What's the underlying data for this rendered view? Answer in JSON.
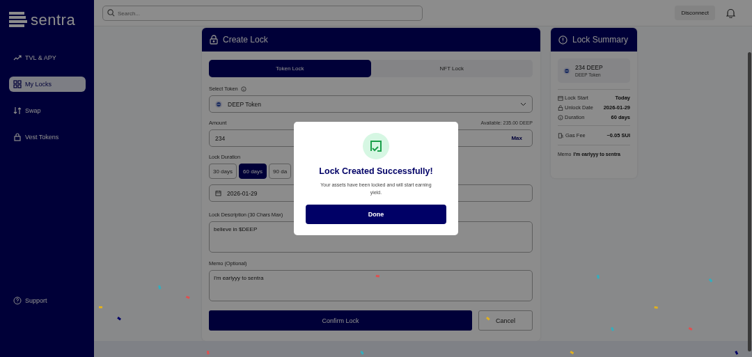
{
  "brand": {
    "name": "sentra"
  },
  "sidebar": {
    "items": [
      {
        "label": "TVL & APY",
        "selected": false
      },
      {
        "label": "My Locks",
        "selected": true
      },
      {
        "label": "Swap",
        "selected": false
      },
      {
        "label": "Vest Tokens",
        "selected": false
      }
    ],
    "footer": {
      "label": "Support"
    }
  },
  "topbar": {
    "search_placeholder": "Search...",
    "disconnect": "Disconnect"
  },
  "create_lock": {
    "title": "Create Lock",
    "tabs": [
      {
        "label": "Token Lock",
        "selected": true
      },
      {
        "label": "NFT Lock",
        "selected": false
      }
    ],
    "select_token": {
      "label": "Select Token",
      "value": "DEEP Token"
    },
    "amount": {
      "label": "Amount",
      "available": "Available: 235.00 DEEP",
      "value": "234",
      "max": "Max"
    },
    "duration": {
      "label": "Lock Duration",
      "options": [
        {
          "label": "30 days",
          "selected": false
        },
        {
          "label": "60 days",
          "selected": true
        },
        {
          "label": "90 da",
          "selected": false
        }
      ]
    },
    "date": {
      "value": "2026-01-29"
    },
    "description": {
      "label": "Lock Description (30 Chars Max)",
      "value": "believe in $DEEP"
    },
    "memo": {
      "label": "Memo (Optional)",
      "value": "I'm earlyyy to sentra"
    },
    "buttons": {
      "confirm": "Confirm Lock",
      "cancel": "Cancel"
    }
  },
  "summary": {
    "title": "Lock Summary",
    "amount": "234 DEEP",
    "token": "DEEP Token",
    "rows": [
      {
        "label": "Lock Start",
        "value": "Today"
      },
      {
        "label": "Unlock Date",
        "value": "2026-01-29"
      },
      {
        "label": "Duration",
        "value": "60 days"
      }
    ],
    "gas": {
      "label": "Gas Fee",
      "value": "~0.05 SUI"
    },
    "memo": {
      "label": "Memo",
      "value": "I'm earlyyy to sentra"
    }
  },
  "modal": {
    "title": "Lock Created Successfully!",
    "message": "Your assets have been locked and will start earning yield.",
    "button": "Done"
  }
}
